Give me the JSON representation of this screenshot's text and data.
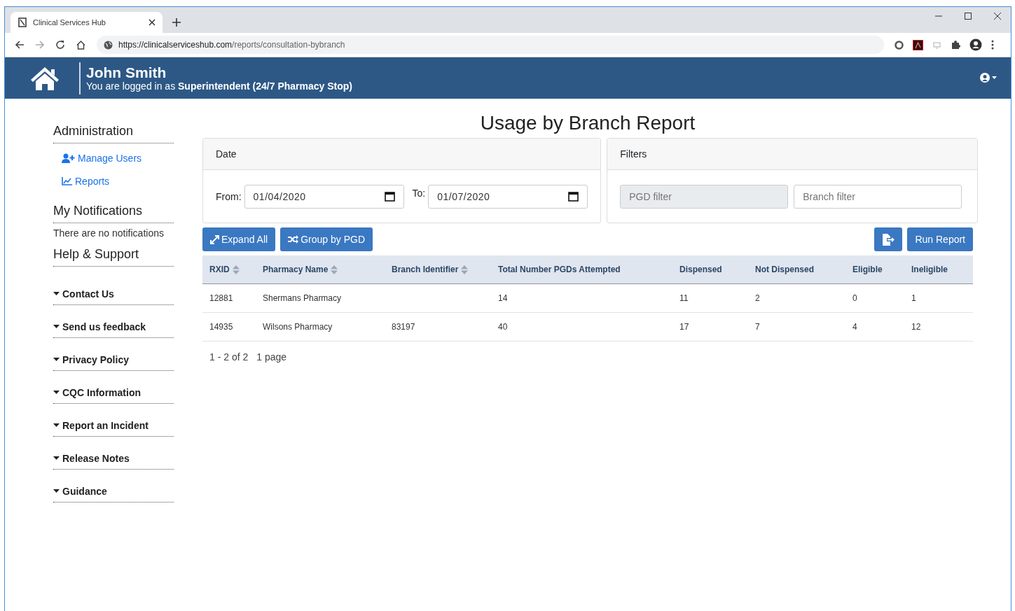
{
  "browser": {
    "tab_title": "Clinical Services Hub",
    "url_host": "https://clinicalserviceshub.com",
    "url_path": "/reports/consultation-bybranch"
  },
  "header": {
    "user_name": "John Smith",
    "login_prefix": "You are logged in as ",
    "login_role": "Superintendent (24/7 Pharmacy Stop)"
  },
  "sidebar": {
    "admin_title": "Administration",
    "admin_links": [
      {
        "label": "Manage Users",
        "kind": "user-add"
      },
      {
        "label": "Reports",
        "kind": "chart"
      }
    ],
    "notifications_title": "My Notifications",
    "notifications_text": "There are no notifications",
    "help_title": "Help & Support",
    "help_items": [
      {
        "label": "Contact Us",
        "expanded": false
      },
      {
        "label": "Send us feedback",
        "expanded": false
      },
      {
        "label": "Privacy Policy",
        "expanded": false
      },
      {
        "label": "CQC Information",
        "expanded": false
      },
      {
        "label": "Report an Incident",
        "expanded": false
      },
      {
        "label": "Release Notes",
        "expanded": false
      },
      {
        "label": "Guidance",
        "expanded": false
      }
    ]
  },
  "page_title": "Usage by Branch Report",
  "date_panel": {
    "title": "Date",
    "from_label": "From:",
    "from_value": "01/04/2020",
    "to_label": "To:",
    "to_value": "01/07/2020"
  },
  "filters_panel": {
    "title": "Filters",
    "fields": [
      {
        "placeholder": "PGD filter",
        "disabled": true
      },
      {
        "placeholder": "Branch filter",
        "disabled": false
      }
    ]
  },
  "buttons": {
    "expand": "Expand All",
    "group": "Group by PGD",
    "run": "Run Report"
  },
  "table": {
    "columns": [
      {
        "label": "RXID",
        "sortable": true
      },
      {
        "label": "Pharmacy Name",
        "sortable": true
      },
      {
        "label": "Branch Identifier",
        "sortable": true
      },
      {
        "label": "Total Number PGDs Attempted",
        "sortable": false
      },
      {
        "label": "Dispensed",
        "sortable": false
      },
      {
        "label": "Not Dispensed",
        "sortable": false
      },
      {
        "label": "Eligible",
        "sortable": false
      },
      {
        "label": "Ineligible",
        "sortable": false
      }
    ],
    "rows": [
      [
        "12881",
        "Shermans Pharmacy",
        "",
        "14",
        "11",
        "2",
        "0",
        "1"
      ],
      [
        "14935",
        "Wilsons Pharmacy",
        "83197",
        "40",
        "17",
        "7",
        "4",
        "12"
      ]
    ]
  },
  "pagination": {
    "range": "1 - 2 of 2",
    "pages": "1 page"
  }
}
